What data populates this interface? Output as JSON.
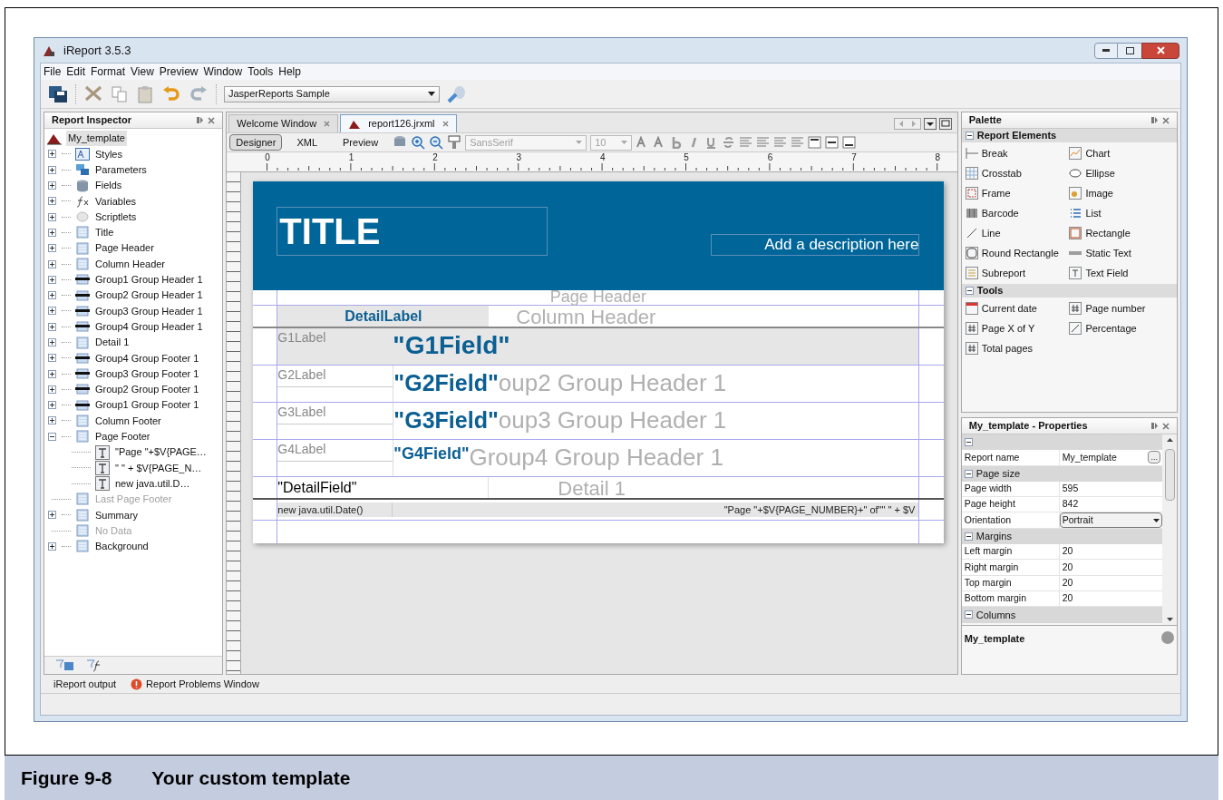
{
  "window": {
    "title": "iReport 3.5.3"
  },
  "menu": [
    "File",
    "Edit",
    "Format",
    "View",
    "Preview",
    "Window",
    "Tools",
    "Help"
  ],
  "toolbar": {
    "datasource": "JasperReports Sample"
  },
  "inspector": {
    "title": "Report Inspector",
    "root": {
      "label": "My_template",
      "selected": true
    },
    "items": [
      {
        "label": "Styles",
        "kind": "styles",
        "expandable": true,
        "expanded": false,
        "disabled": false
      },
      {
        "label": "Parameters",
        "kind": "parameters",
        "expandable": true,
        "expanded": false,
        "disabled": false
      },
      {
        "label": "Fields",
        "kind": "fields",
        "expandable": true,
        "expanded": false,
        "disabled": false
      },
      {
        "label": "Variables",
        "kind": "variables",
        "expandable": true,
        "expanded": false,
        "disabled": false
      },
      {
        "label": "Scriptlets",
        "kind": "scriptlets",
        "expandable": true,
        "expanded": false,
        "disabled": false
      },
      {
        "label": "Title",
        "kind": "band",
        "expandable": true,
        "expanded": false,
        "disabled": false
      },
      {
        "label": "Page Header",
        "kind": "band",
        "expandable": true,
        "expanded": false,
        "disabled": false
      },
      {
        "label": "Column Header",
        "kind": "band",
        "expandable": true,
        "expanded": false,
        "disabled": false
      },
      {
        "label": "Group1 Group Header 1",
        "kind": "group",
        "expandable": true,
        "expanded": false,
        "disabled": false
      },
      {
        "label": "Group2 Group Header 1",
        "kind": "group",
        "expandable": true,
        "expanded": false,
        "disabled": false
      },
      {
        "label": "Group3 Group Header 1",
        "kind": "group",
        "expandable": true,
        "expanded": false,
        "disabled": false
      },
      {
        "label": "Group4 Group Header 1",
        "kind": "group",
        "expandable": true,
        "expanded": false,
        "disabled": false
      },
      {
        "label": "Detail 1",
        "kind": "band",
        "expandable": true,
        "expanded": false,
        "disabled": false
      },
      {
        "label": "Group4 Group Footer 1",
        "kind": "group",
        "expandable": true,
        "expanded": false,
        "disabled": false
      },
      {
        "label": "Group3 Group Footer 1",
        "kind": "group",
        "expandable": true,
        "expanded": false,
        "disabled": false
      },
      {
        "label": "Group2 Group Footer 1",
        "kind": "group",
        "expandable": true,
        "expanded": false,
        "disabled": false
      },
      {
        "label": "Group1 Group Footer 1",
        "kind": "group",
        "expandable": true,
        "expanded": false,
        "disabled": false
      },
      {
        "label": "Column Footer",
        "kind": "band",
        "expandable": true,
        "expanded": false,
        "disabled": false
      },
      {
        "label": "Page Footer",
        "kind": "band",
        "expandable": true,
        "expanded": true,
        "disabled": false,
        "children": [
          {
            "label": "\"Page \"+$V{PAGE…",
            "kind": "textfield",
            "expandable": false,
            "expanded": false,
            "disabled": false
          },
          {
            "label": "\" \" + $V{PAGE_N…",
            "kind": "textfield",
            "expandable": false,
            "expanded": false,
            "disabled": false
          },
          {
            "label": "new java.util.D…",
            "kind": "textfield",
            "expandable": false,
            "expanded": false,
            "disabled": false
          }
        ]
      },
      {
        "label": "Last Page Footer",
        "kind": "band",
        "expandable": false,
        "expanded": false,
        "disabled": true
      },
      {
        "label": "Summary",
        "kind": "band",
        "expandable": true,
        "expanded": false,
        "disabled": false
      },
      {
        "label": "No Data",
        "kind": "band",
        "expandable": false,
        "expanded": false,
        "disabled": true
      },
      {
        "label": "Background",
        "kind": "band",
        "expandable": true,
        "expanded": false,
        "disabled": false
      }
    ]
  },
  "editor_tabs": [
    {
      "label": "Welcome Window",
      "selected": false
    },
    {
      "label": "report126.jrxml",
      "selected": true
    }
  ],
  "view_tabs": [
    {
      "label": "Designer",
      "selected": true
    },
    {
      "label": "XML",
      "selected": false
    },
    {
      "label": "Preview",
      "selected": false
    }
  ],
  "font": {
    "family": "SansSerif",
    "size": "10"
  },
  "ruler": [
    "0",
    "1",
    "2",
    "3",
    "4",
    "5",
    "6",
    "7",
    "8"
  ],
  "report": {
    "title": "TITLE",
    "description": "Add a description here",
    "page_header": "Page Header",
    "detail_label": "DetailLabel",
    "column_header": "Column Header",
    "groups": [
      {
        "label": "G1Label",
        "field": "\"G1Field\""
      },
      {
        "label": "G2Label",
        "field": "\"G2Field\"",
        "band": "oup2 Group Header 1"
      },
      {
        "label": "G3Label",
        "field": "\"G3Field\"",
        "band": "oup3 Group Header 1"
      },
      {
        "label": "G4Label",
        "field": "\"G4Field\"",
        "band": "Group4 Group Header 1"
      }
    ],
    "detail_field": "\"DetailField\"",
    "detail_band": "Detail 1",
    "footer_date": "new java.util.Date()",
    "footer_page": "\"Page \"+$V{PAGE_NUMBER}+\" of\"\" \" + $V"
  },
  "palette": {
    "title": "Palette",
    "sections": [
      {
        "title": "Report Elements",
        "items": [
          "Break",
          "Chart",
          "Crosstab",
          "Ellipse",
          "Frame",
          "Image",
          "Barcode",
          "List",
          "Line",
          "Rectangle",
          "Round Rectangle",
          "Static Text",
          "Subreport",
          "Text Field"
        ]
      },
      {
        "title": "Tools",
        "items": [
          "Current date",
          "Page number",
          "Page X of Y",
          "Percentage",
          "Total pages"
        ]
      }
    ]
  },
  "properties": {
    "title": "My_template - Properties",
    "rows": [
      {
        "kind": "section",
        "label": ""
      },
      {
        "kind": "text",
        "label": "Report name",
        "value": "My_template",
        "button": "..."
      },
      {
        "kind": "section",
        "label": "Page size"
      },
      {
        "kind": "text",
        "label": "Page width",
        "value": "595"
      },
      {
        "kind": "text",
        "label": "Page height",
        "value": "842"
      },
      {
        "kind": "combo",
        "label": "Orientation",
        "value": "Portrait"
      },
      {
        "kind": "section",
        "label": "Margins"
      },
      {
        "kind": "text",
        "label": "Left margin",
        "value": "20"
      },
      {
        "kind": "text",
        "label": "Right margin",
        "value": "20"
      },
      {
        "kind": "text",
        "label": "Top margin",
        "value": "20"
      },
      {
        "kind": "text",
        "label": "Bottom margin",
        "value": "20"
      },
      {
        "kind": "section",
        "label": "Columns"
      }
    ],
    "description": "My_template"
  },
  "output_tabs": [
    {
      "label": "iReport output",
      "kind": "plain"
    },
    {
      "label": "Report Problems Window",
      "kind": "error"
    }
  ],
  "caption": {
    "number": "Figure 9-8",
    "text": "Your custom template"
  }
}
